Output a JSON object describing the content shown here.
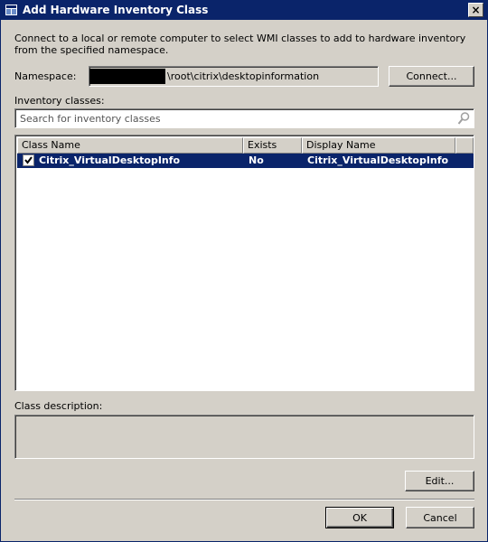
{
  "window": {
    "title": "Add Hardware Inventory Class",
    "close_label": "×"
  },
  "intro_text": "Connect to a local or remote computer to select WMI classes to add to hardware inventory from the specified namespace.",
  "namespace": {
    "label": "Namespace:",
    "value": "\\root\\citrix\\desktopinformation",
    "connect_label": "Connect..."
  },
  "inventory": {
    "label": "Inventory classes:",
    "search_placeholder": "Search for inventory classes",
    "columns": [
      "Class Name",
      "Exists",
      "Display Name",
      ""
    ],
    "rows": [
      {
        "checked": true,
        "class_name": "Citrix_VirtualDesktopInfo",
        "exists": "No",
        "display_name": "Citrix_VirtualDesktopInfo"
      }
    ]
  },
  "description": {
    "label": "Class description:",
    "text": ""
  },
  "buttons": {
    "edit_label": "Edit...",
    "ok_label": "OK",
    "cancel_label": "Cancel"
  },
  "colors": {
    "selection": "#0a246a",
    "face": "#d4d0c8"
  },
  "icons": {
    "window": "dialog-icon",
    "search": "magnifier-icon",
    "check": "checkmark-icon"
  }
}
